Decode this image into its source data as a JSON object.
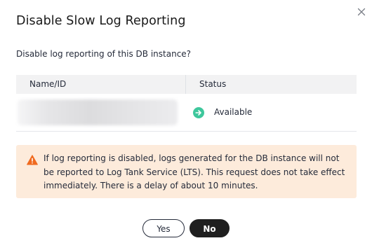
{
  "dialog": {
    "title": "Disable Slow Log Reporting",
    "question": "Disable log reporting of this DB instance?",
    "close_icon": "close-icon"
  },
  "table": {
    "columns": [
      "Name/ID",
      "Status"
    ],
    "rows": [
      {
        "name_id": "",
        "status": "Available",
        "status_icon": "arrow-right-circle-icon",
        "status_color": "#3ec79c"
      }
    ]
  },
  "warning": {
    "icon": "warning-triangle-icon",
    "icon_color": "#f06a1f",
    "background_color": "#fdebdb",
    "text": "If log reporting is disabled, logs generated for the DB instance will not be reported to Log Tank Service (LTS). This request does not take effect immediately. There is a delay of about 10 minutes."
  },
  "buttons": {
    "yes_label": "Yes",
    "no_label": "No"
  },
  "colors": {
    "primary_button": "#1f1f1f",
    "text": "#252b3a"
  }
}
